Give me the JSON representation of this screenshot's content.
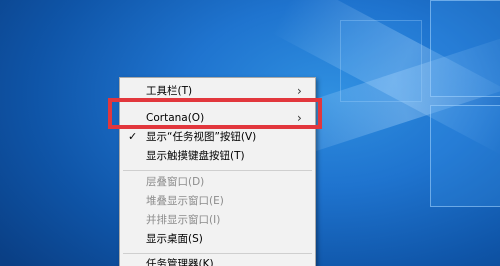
{
  "context_menu": {
    "items": [
      {
        "label": "工具栏(T)",
        "has_submenu": true,
        "enabled": true,
        "checked": false
      },
      {
        "label": "Cortana(O)",
        "has_submenu": true,
        "enabled": true,
        "checked": false
      },
      {
        "label": "显示“任务视图”按钮(V)",
        "has_submenu": false,
        "enabled": true,
        "checked": true
      },
      {
        "label": "显示触摸键盘按钮(T)",
        "has_submenu": false,
        "enabled": true,
        "checked": false
      },
      {
        "label": "层叠窗口(D)",
        "has_submenu": false,
        "enabled": false,
        "checked": false
      },
      {
        "label": "堆叠显示窗口(E)",
        "has_submenu": false,
        "enabled": false,
        "checked": false
      },
      {
        "label": "并排显示窗口(I)",
        "has_submenu": false,
        "enabled": false,
        "checked": false
      },
      {
        "label": "显示桌面(S)",
        "has_submenu": false,
        "enabled": true,
        "checked": false
      },
      {
        "label": "任务管理器(K)",
        "has_submenu": false,
        "enabled": true,
        "checked": false
      }
    ],
    "check_glyph": "✓",
    "submenu_glyph": "›"
  },
  "highlight": {
    "target": "Cortana(O)",
    "color": "#e2373d"
  },
  "desktop": {
    "wallpaper": "windows-10-default-blue"
  }
}
